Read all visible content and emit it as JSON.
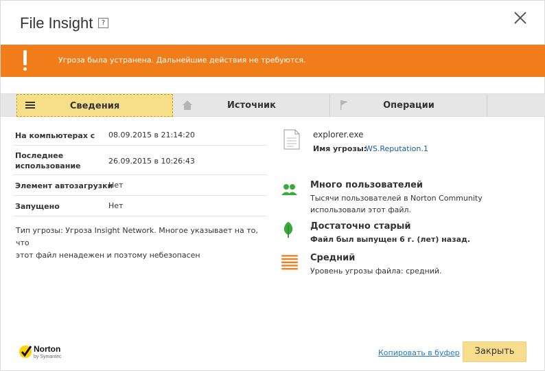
{
  "window": {
    "title": "File Insight",
    "help_label": "?"
  },
  "alert": {
    "text": "Угроза была устранена. Дальнейшие действия не требуются.",
    "color": "#f07d1a"
  },
  "tabs": [
    {
      "label": "Сведения",
      "icon": "list-icon",
      "active": true
    },
    {
      "label": "Источник",
      "icon": "home-icon",
      "active": false
    },
    {
      "label": "Операции",
      "icon": "flag-icon",
      "active": false
    }
  ],
  "details": [
    {
      "key": "На компьютерах с",
      "value": "08.09.2015 в 21:14:20"
    },
    {
      "key": "Последнее использование",
      "key_lines": [
        "Последнее",
        "использование"
      ],
      "value": "26.09.2015 в 10:26:43"
    },
    {
      "key": "Элемент автозагрузки",
      "value": "Нет"
    },
    {
      "key": "Запущено",
      "value": "Нет"
    }
  ],
  "description": {
    "line1": "Тип угрозы: Угроза Insight Network. Многое указывает на то, что",
    "line2": "этот файл ненадежен и поэтому небезопасен"
  },
  "file": {
    "name": "explorer.exe",
    "threat_label": "Имя угрозы:",
    "threat_value": "WS.Reputation.1"
  },
  "insights": [
    {
      "icon": "users-icon",
      "title": "Много пользователей",
      "line1": "Тысячи пользователей в Norton Community",
      "line2": "использовали этот файл."
    },
    {
      "icon": "leaf-icon",
      "title": "Достаточно старый",
      "line1": "Файл был выпущен 6 г. (лет) назад.",
      "line2": ""
    },
    {
      "icon": "stripes-icon",
      "title": "Средний",
      "line1": "Уровень угрозы файла: средний.",
      "line2": ""
    }
  ],
  "footer": {
    "brand": "Norton",
    "brand_sub": "by Symantec",
    "copy_link": "Копировать в буфер",
    "close_button": "Закрыть"
  },
  "colors": {
    "accent_orange": "#f07d1a",
    "tab_active": "#f7df8a",
    "button": "#f8dd8c",
    "link": "#1e78c8",
    "green": "#3aa83a"
  }
}
